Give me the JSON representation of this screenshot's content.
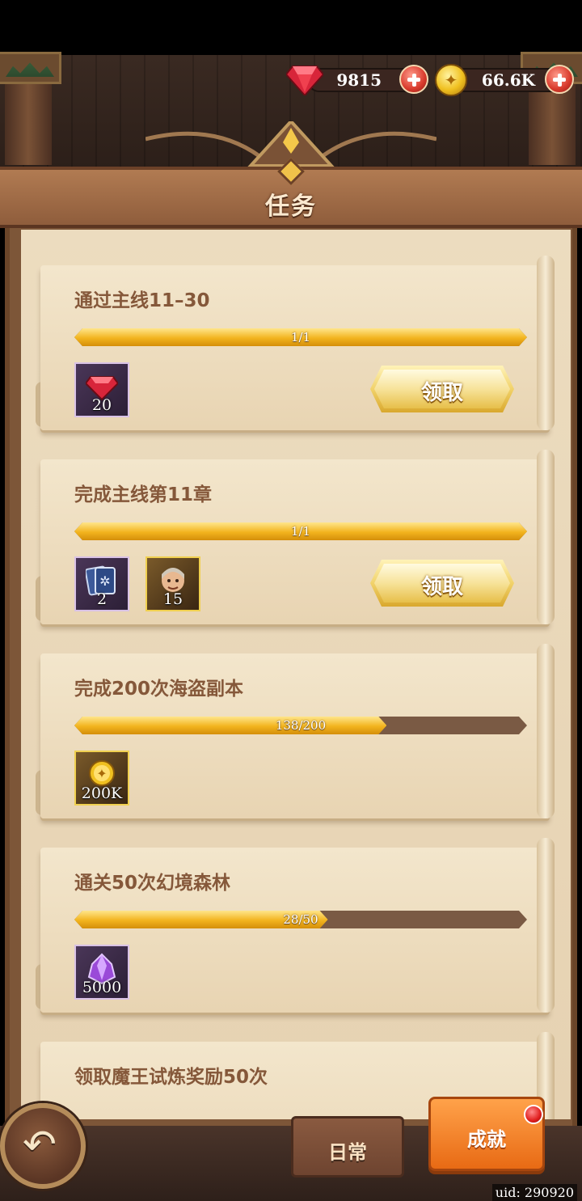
{
  "currency": {
    "gems": "9815",
    "gold": "66.6K"
  },
  "header": {
    "title": "任务"
  },
  "tasks": [
    {
      "title": "通过主线11–30",
      "progress_text": "1/1",
      "progress": 1.0,
      "rewards": [
        {
          "icon": "gem-icon",
          "qty": "20"
        }
      ],
      "claim_label": "领取"
    },
    {
      "title": "完成主线第11章",
      "progress_text": "1/1",
      "progress": 1.0,
      "rewards": [
        {
          "icon": "card-icon",
          "qty": "2"
        },
        {
          "icon": "hero-shard-icon",
          "qty": "15"
        }
      ],
      "claim_label": "领取"
    },
    {
      "title": "完成200次海盗副本",
      "progress_text": "138/200",
      "progress": 0.69,
      "rewards": [
        {
          "icon": "coin-icon",
          "qty": "200K"
        }
      ]
    },
    {
      "title": "通关50次幻境森林",
      "progress_text": "28/50",
      "progress": 0.56,
      "rewards": [
        {
          "icon": "crystal-icon",
          "qty": "5000"
        }
      ]
    },
    {
      "title": "领取魔王试炼奖励50次"
    }
  ],
  "tabs": {
    "daily": "日常",
    "achievement": "成就"
  },
  "uid": "uid: 290920",
  "colors": {
    "accent_gold": "#f2b41e",
    "tab_active": "#e86a14",
    "paper": "#ecdcbf"
  }
}
